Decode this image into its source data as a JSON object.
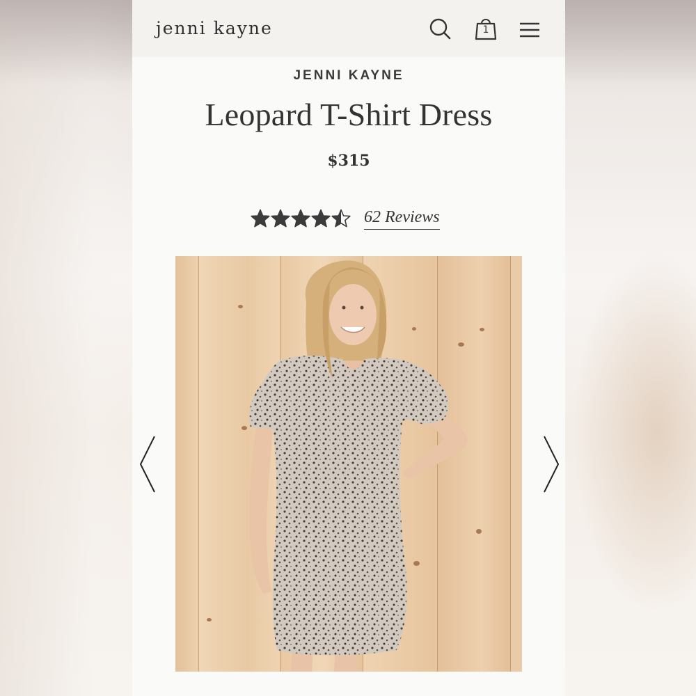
{
  "header": {
    "logo_text": "jenni kayne",
    "bag_count": "1",
    "icons": [
      "search-icon",
      "shopping-bag-icon",
      "hamburger-menu-icon"
    ]
  },
  "product": {
    "brand": "JENNI KAYNE",
    "title": "Leopard T-Shirt Dress",
    "price": "$315",
    "rating": 4.5,
    "rating_max": 5,
    "reviews_label": "62 Reviews",
    "image_alt": "Model wearing leopard t-shirt dress against light wood wall"
  },
  "carousel": {
    "prev_icon": "chevron-left-icon",
    "next_icon": "chevron-right-icon"
  },
  "colors": {
    "text": "#333333",
    "header_bg": "#f4f2ef",
    "page_bg": "#fafbf9",
    "star": "#3b3b3b"
  }
}
